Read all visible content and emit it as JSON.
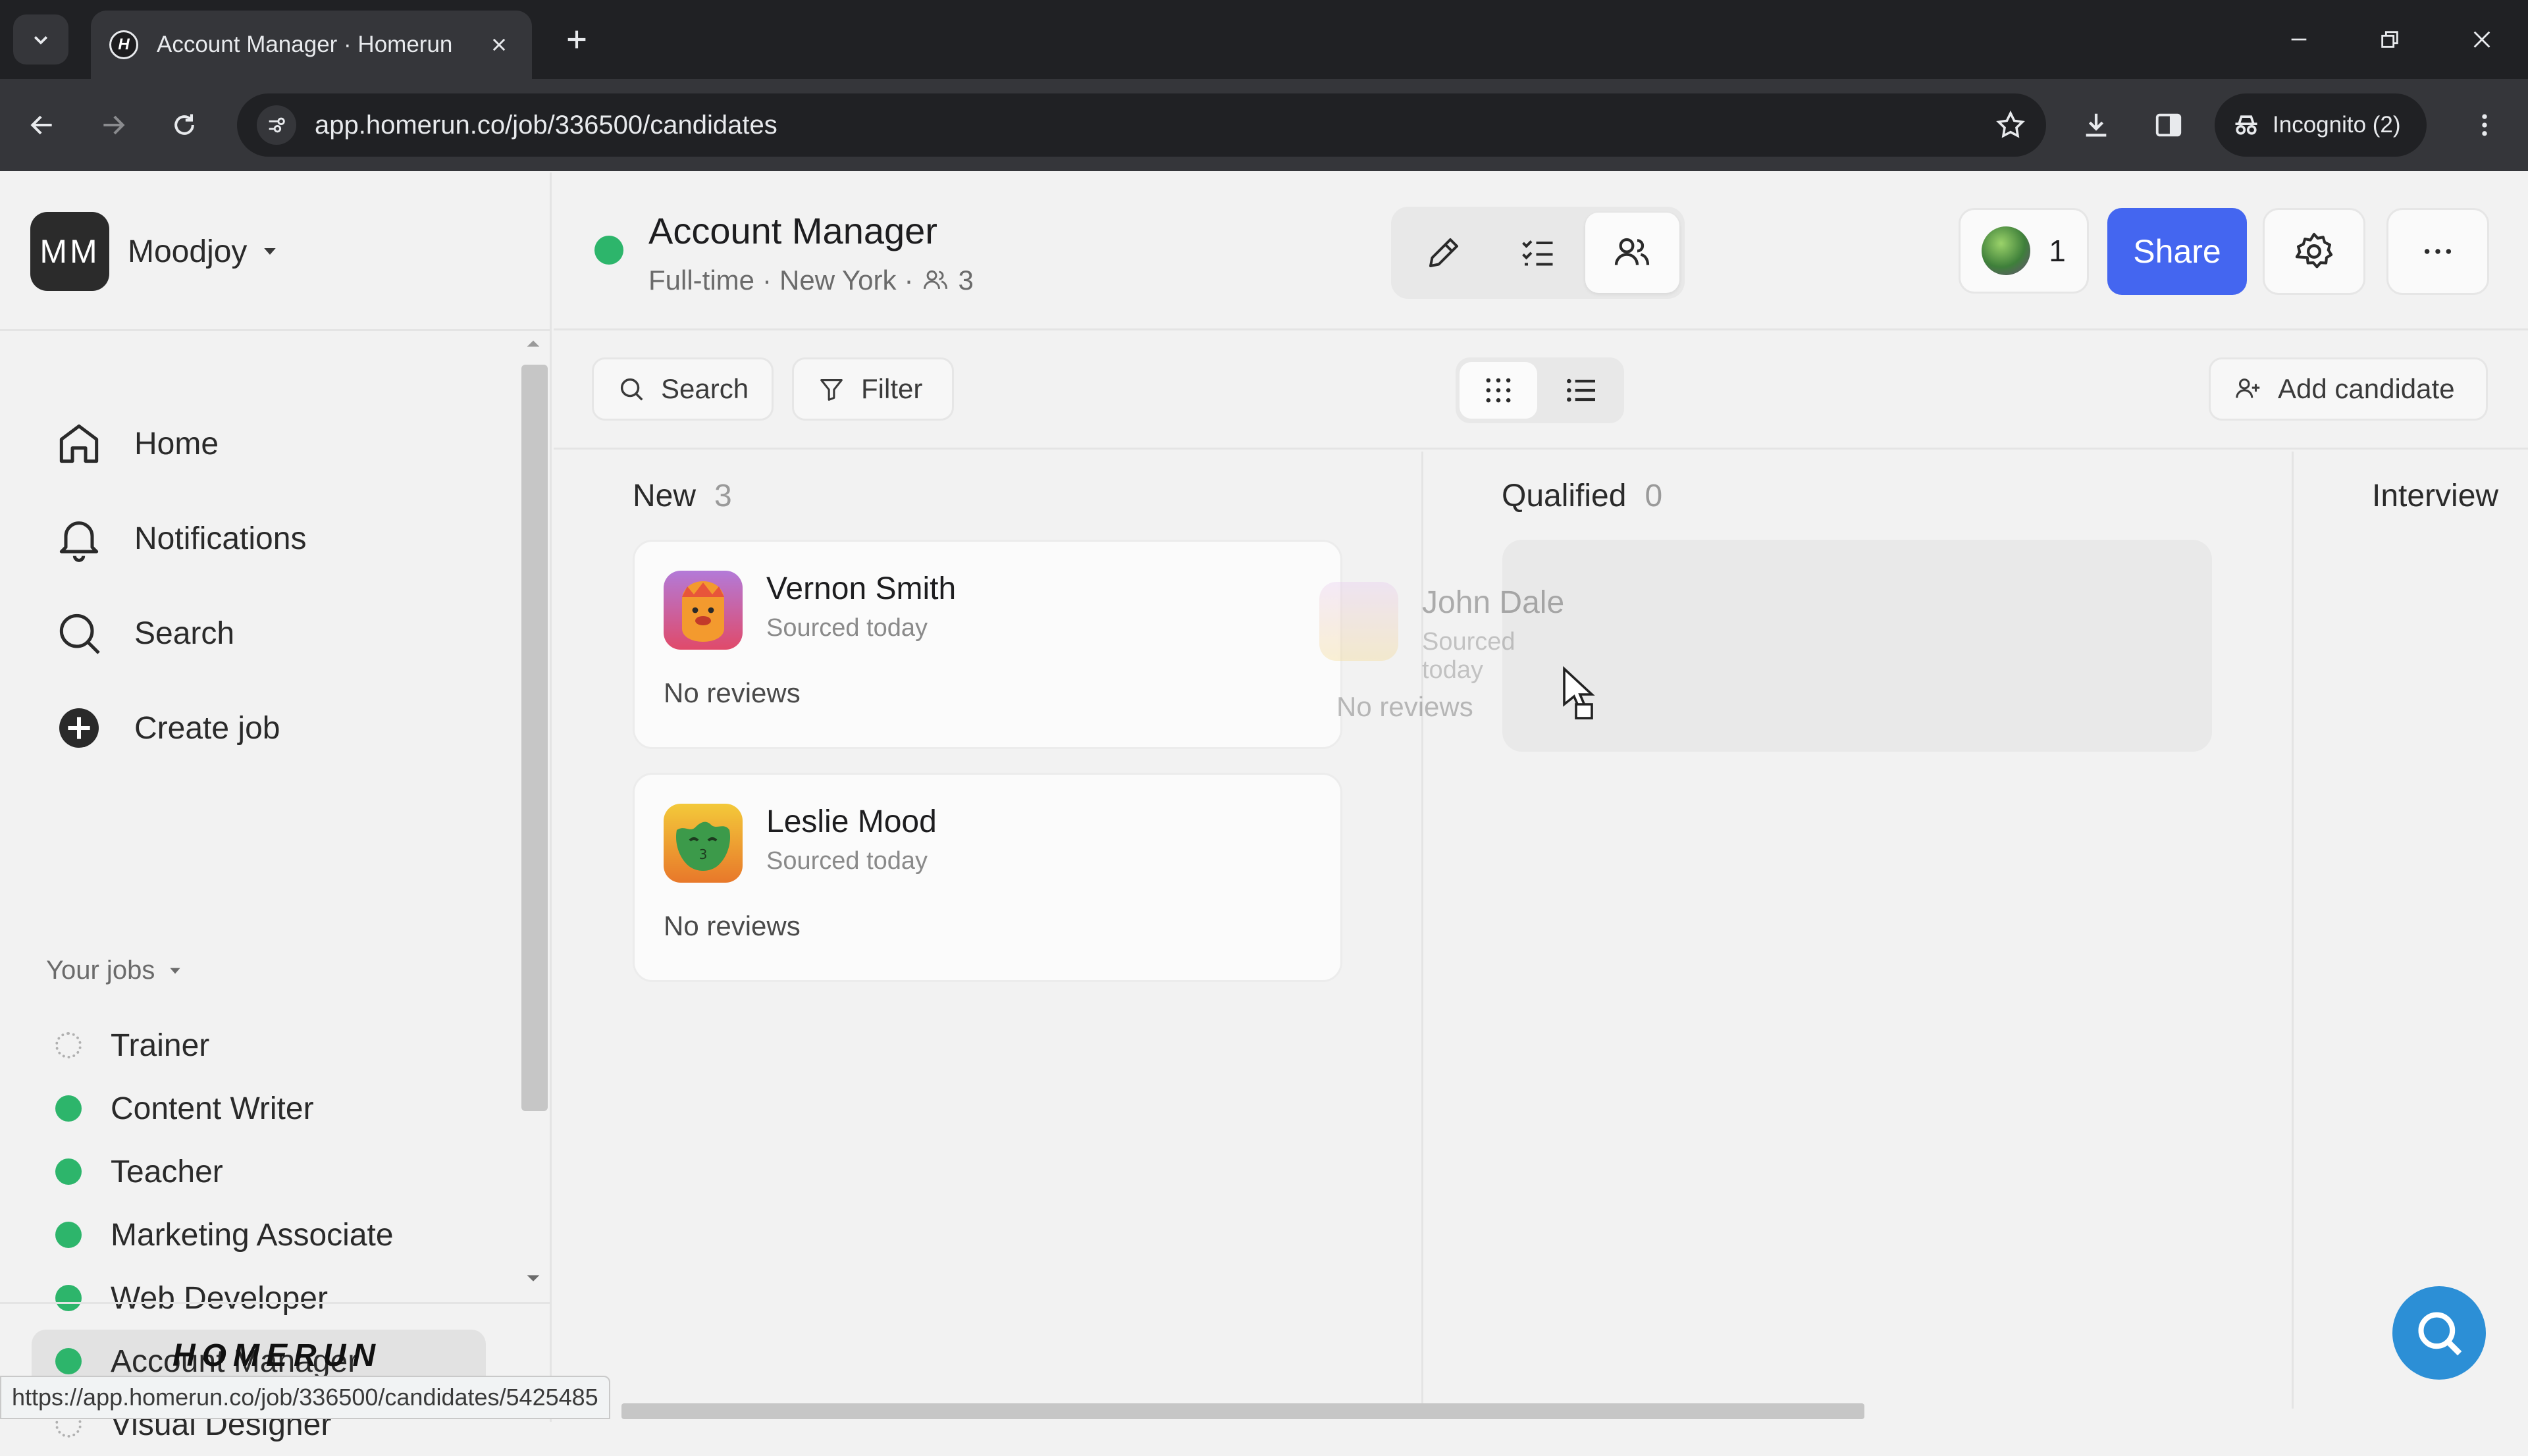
{
  "browser": {
    "tab_title": "Account Manager · Homerun",
    "url": "app.homerun.co/job/336500/candidates",
    "incognito_label": "Incognito (2)",
    "status_url": "https://app.homerun.co/job/336500/candidates/5425485"
  },
  "workspace": {
    "initials": "MM",
    "name": "Moodjoy"
  },
  "sidebar": {
    "nav": [
      {
        "label": "Home",
        "icon": "home-icon"
      },
      {
        "label": "Notifications",
        "icon": "bell-icon"
      },
      {
        "label": "Search",
        "icon": "search-icon"
      },
      {
        "label": "Create job",
        "icon": "plus-circle-icon"
      }
    ],
    "jobs_heading": "Your jobs",
    "jobs": [
      {
        "name": "Trainer",
        "status": "draft"
      },
      {
        "name": "Content Writer",
        "status": "published"
      },
      {
        "name": "Teacher",
        "status": "published"
      },
      {
        "name": "Marketing Associate",
        "status": "published"
      },
      {
        "name": "Web Developer",
        "status": "published"
      },
      {
        "name": "Account Manager",
        "status": "published",
        "active": true
      },
      {
        "name": "Visual Designer",
        "status": "draft"
      }
    ],
    "logo": "HOMERUN"
  },
  "header": {
    "title": "Account Manager",
    "type": "Full-time",
    "location": "New York",
    "candidate_count": "3",
    "collaborators": "1",
    "share_label": "Share"
  },
  "toolbar": {
    "search_label": "Search",
    "filter_label": "Filter",
    "add_candidate_label": "Add candidate"
  },
  "board": {
    "columns": [
      {
        "name": "New",
        "count": "3"
      },
      {
        "name": "Qualified",
        "count": "0"
      },
      {
        "name": "Interview",
        "count": ""
      }
    ],
    "cards": [
      {
        "name": "Vernon Smith",
        "source": "Sourced today",
        "reviews": "No reviews"
      },
      {
        "name": "Leslie Mood",
        "source": "Sourced today",
        "reviews": "No reviews"
      }
    ],
    "dragging": {
      "name": "John Dale",
      "source": "Sourced today",
      "reviews": "No reviews"
    }
  },
  "colors": {
    "accent": "#4466f0",
    "published": "#2db56b",
    "fab": "#2c8fd6"
  }
}
